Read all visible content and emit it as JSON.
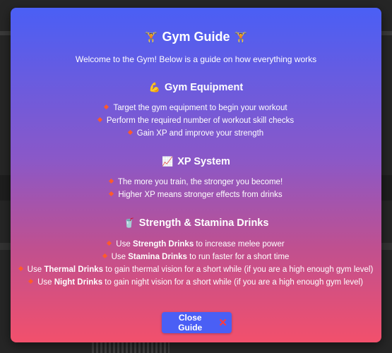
{
  "modal": {
    "title": "Gym Guide",
    "title_icon_left": "🏋",
    "title_icon_right": "🏋",
    "subtitle": "Welcome to the Gym! Below is a guide on how everything works",
    "sections": [
      {
        "icon": "💪",
        "title": "Gym Equipment",
        "items": [
          {
            "pre": "Target the gym equipment to begin your workout",
            "bold": "",
            "post": ""
          },
          {
            "pre": "Perform the required number of workout skill checks",
            "bold": "",
            "post": ""
          },
          {
            "pre": "Gain XP and improve your strength",
            "bold": "",
            "post": ""
          }
        ]
      },
      {
        "icon": "📈",
        "title": "XP System",
        "items": [
          {
            "pre": "The more you train, the stronger you become!",
            "bold": "",
            "post": ""
          },
          {
            "pre": "Higher XP means stronger effects from drinks",
            "bold": "",
            "post": ""
          }
        ]
      },
      {
        "icon": "🥤",
        "title": "Strength & Stamina Drinks",
        "items": [
          {
            "pre": "Use ",
            "bold": "Strength Drinks",
            "post": " to increase melee power"
          },
          {
            "pre": "Use ",
            "bold": "Stamina Drinks",
            "post": " to run faster for a short time"
          },
          {
            "pre": "Use ",
            "bold": "Thermal Drinks",
            "post": " to gain thermal vision for a short while (if you are a high enough gym level)"
          },
          {
            "pre": "Use ",
            "bold": "Night Drinks",
            "post": " to gain night vision for a short while (if you are a high enough gym level)"
          }
        ]
      }
    ],
    "close_button": {
      "label": "Close Guide",
      "icon": "✕"
    }
  },
  "colors": {
    "gradient_top": "#4a5ff5",
    "gradient_bottom": "#f2506c",
    "bullet": "#ff5a2a",
    "button": "#4a5ff5",
    "close_icon": "#ff3b3b"
  }
}
